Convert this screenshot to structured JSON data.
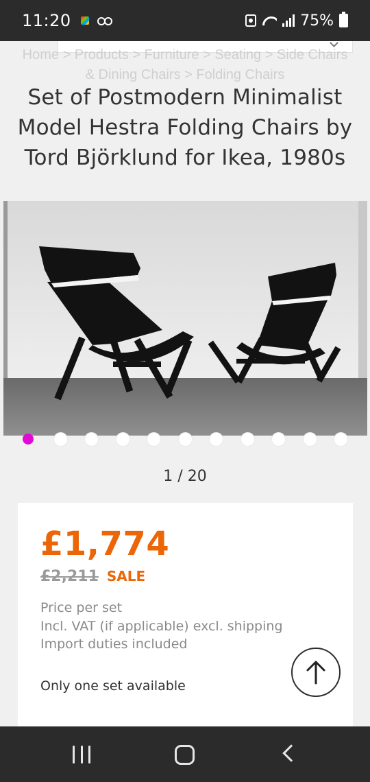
{
  "status_bar": {
    "time": "11:20",
    "battery": "75%",
    "icons": [
      "gallery-icon",
      "voicemail-icon",
      "recycle-icon",
      "wifi-icon",
      "signal-icon",
      "battery-icon"
    ]
  },
  "breadcrumb": {
    "text": "Home > Products > Furniture > Seating > Side Chairs & Dining Chairs > Folding Chairs"
  },
  "product": {
    "title": "Set of Postmodern Minimalist Model Hestra Folding Chairs by Tord Björklund for Ikea, 1980s"
  },
  "gallery": {
    "counter": "1 / 20",
    "dot_count": 11,
    "active_dot": 0,
    "active_color": "#e10ad5"
  },
  "pricing": {
    "current_price": "£1,774",
    "original_price": "£2,211",
    "sale_label": "SALE",
    "note_per": "Price per set",
    "note_vat": "Incl. VAT (if applicable) excl. shipping",
    "note_duties": "Import duties included",
    "availability": "Only one set available",
    "accent_color": "#ec6608"
  },
  "nav": {
    "icons": [
      "recent-apps-icon",
      "home-icon",
      "back-icon"
    ]
  }
}
